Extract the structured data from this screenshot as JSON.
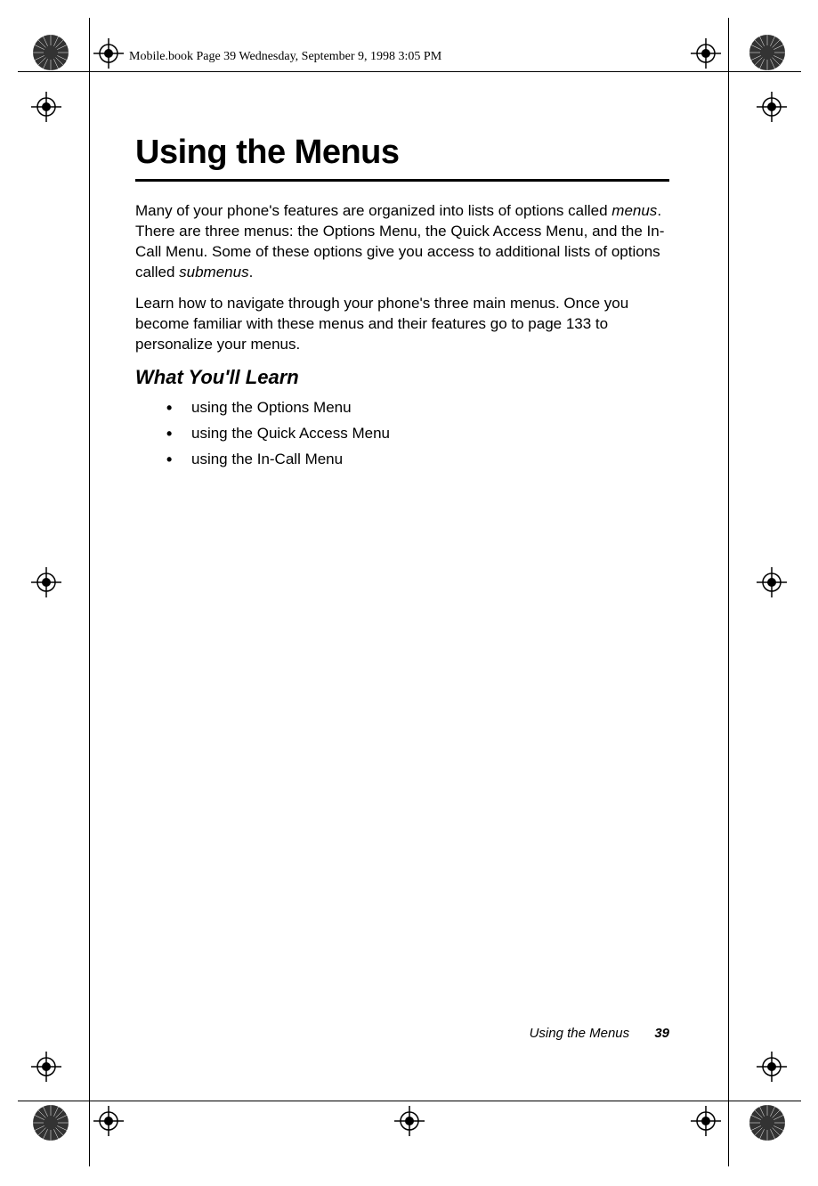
{
  "header": {
    "runningHead": "Mobile.book  Page 39  Wednesday, September 9, 1998  3:05 PM"
  },
  "content": {
    "chapterTitle": "Using the Menus",
    "para1_part1": "Many of your phone's features are organized into lists of options called ",
    "para1_italic1": "menus",
    "para1_part2": ". There are three menus: the Options Menu, the Quick Access Menu, and the In-Call Menu. Some of these options give you access to additional lists of options called ",
    "para1_italic2": "submenus",
    "para1_part3": ".",
    "para2": "Learn how to navigate through your phone's three main menus. Once you become familiar with these menus and their features go to page 133 to personalize your menus.",
    "sectionHeading": "What You'll Learn",
    "bullets": [
      "using the Options Menu",
      "using the Quick Access Menu",
      "using the In-Call Menu"
    ]
  },
  "footer": {
    "sectionName": "Using the Menus",
    "pageNumber": "39"
  }
}
